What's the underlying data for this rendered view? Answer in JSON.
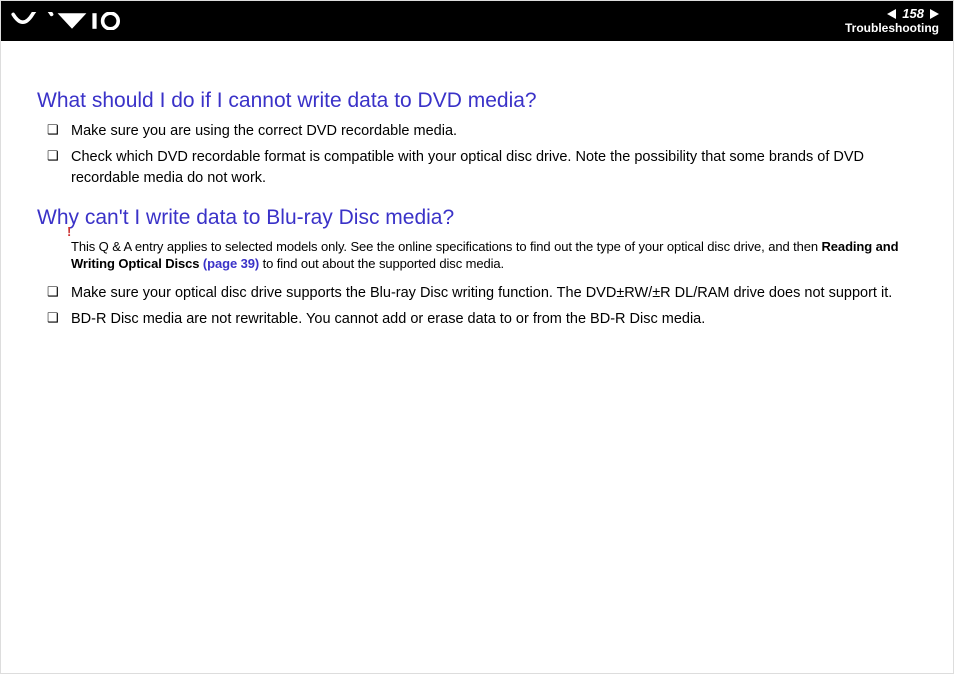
{
  "header": {
    "page_number": "158",
    "section": "Troubleshooting"
  },
  "q1": {
    "title": "What should I do if I cannot write data to DVD media?",
    "bullet1": "Make sure you are using the correct DVD recordable media.",
    "bullet2": "Check which DVD recordable format is compatible with your optical disc drive. Note the possibility that some brands of DVD recordable media do not work."
  },
  "q2": {
    "title": "Why can't I write data to Blu-ray Disc media?",
    "note_bang": "!",
    "note_part1": "This Q & A entry applies to selected models only. See the online specifications to find out the type of your optical disc drive, and then ",
    "note_bold": "Reading and Writing Optical Discs ",
    "note_pageref": "(page 39)",
    "note_part2": " to find out about the supported disc media.",
    "bullet1": "Make sure your optical disc drive supports the Blu-ray Disc writing function. The DVD±RW/±R DL/RAM drive does not support it.",
    "bullet2": "BD-R Disc media are not rewritable. You cannot add or erase data to or from the BD-R Disc media."
  }
}
